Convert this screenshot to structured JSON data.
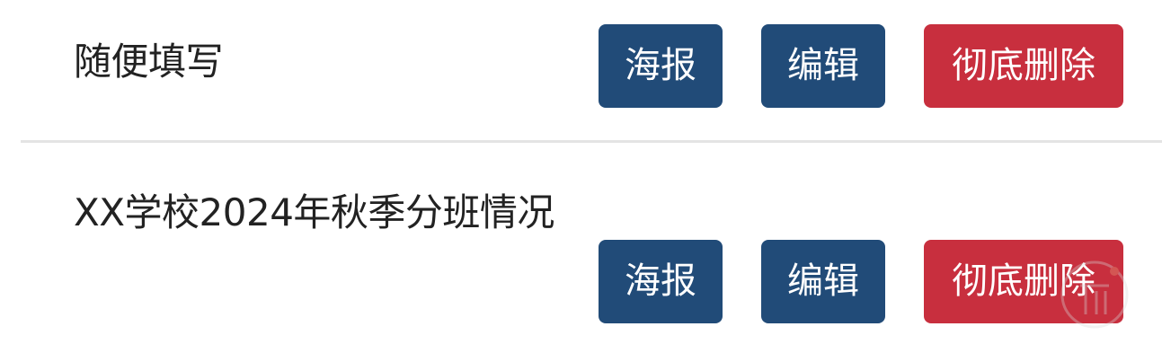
{
  "items": [
    {
      "title": "随便填写",
      "poster_label": "海报",
      "edit_label": "编辑",
      "delete_label": "彻底删除"
    },
    {
      "title": "XX学校2024年秋季分班情况",
      "poster_label": "海报",
      "edit_label": "编辑",
      "delete_label": "彻底删除"
    }
  ],
  "colors": {
    "primary": "#214b78",
    "danger": "#c82f3e",
    "divider": "#e4e4e4",
    "text": "#222222"
  }
}
